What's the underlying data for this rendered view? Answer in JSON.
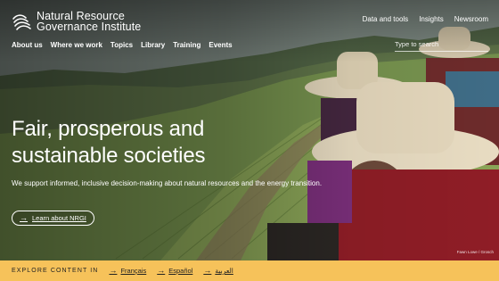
{
  "brand": {
    "line1": "Natural Resource",
    "line2": "Governance Institute"
  },
  "utility_nav": [
    "Data and tools",
    "Insights",
    "Newsroom"
  ],
  "main_nav": [
    "About us",
    "Where we work",
    "Topics",
    "Library",
    "Training",
    "Events"
  ],
  "search": {
    "placeholder": "Type to search"
  },
  "hero": {
    "title_line1": "Fair, prosperous and",
    "title_line2": "sustainable societies",
    "subtitle": "We support informed, inclusive decision-making about natural resources and the energy transition.",
    "cta_label": "Learn about NRGI",
    "photo_credit": "Fawn Lowe / Grosch"
  },
  "language_bar": {
    "label": "EXPLORE CONTENT IN",
    "languages": [
      "Français",
      "Español",
      "العربية"
    ]
  },
  "colors": {
    "accent_yellow": "#f6c25a",
    "text_white": "#ffffff"
  },
  "icons": {
    "logo": "nrgi-logo-icon",
    "arrow": "arrow-right-icon"
  }
}
